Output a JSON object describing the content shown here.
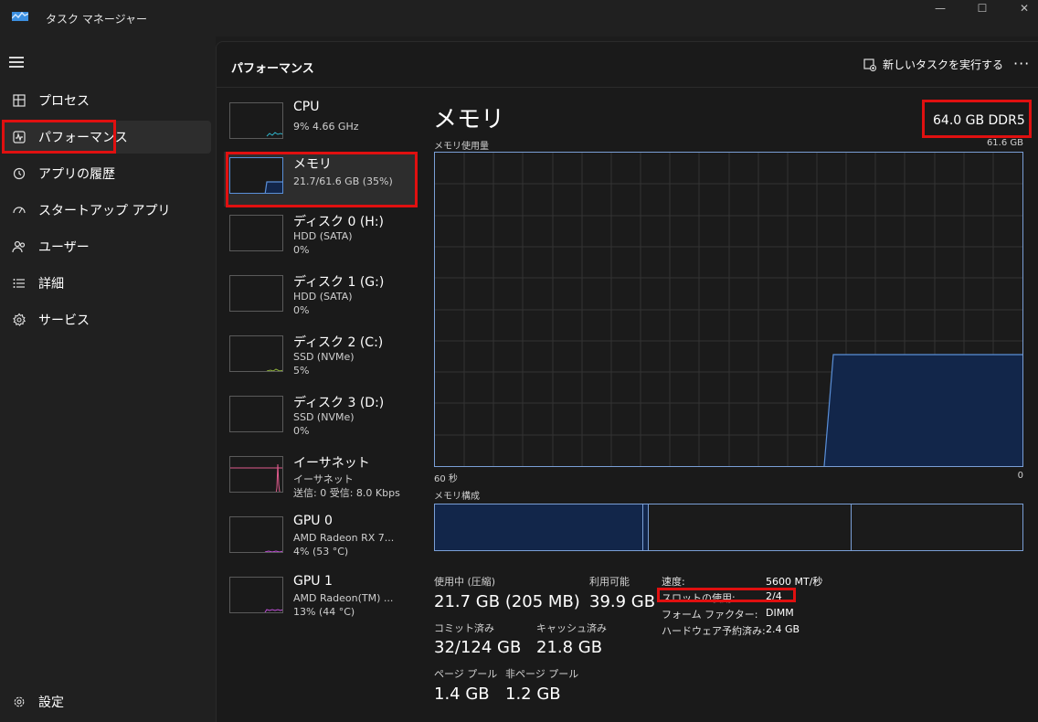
{
  "window": {
    "title": "タスク マネージャー",
    "minimize": "—",
    "maximize": "☐",
    "close": "✕"
  },
  "nav": {
    "items": [
      {
        "label": "プロセス",
        "icon": "processes-icon"
      },
      {
        "label": "パフォーマンス",
        "icon": "performance-icon"
      },
      {
        "label": "アプリの履歴",
        "icon": "history-icon"
      },
      {
        "label": "スタートアップ アプリ",
        "icon": "startup-icon"
      },
      {
        "label": "ユーザー",
        "icon": "users-icon"
      },
      {
        "label": "詳細",
        "icon": "details-icon"
      },
      {
        "label": "サービス",
        "icon": "services-icon"
      }
    ],
    "settings_label": "設定"
  },
  "header": {
    "title": "パフォーマンス",
    "run_task_label": "新しいタスクを実行する",
    "more_label": "···"
  },
  "devices": [
    {
      "name": "CPU",
      "lines": [
        "9%  4.66 GHz"
      ]
    },
    {
      "name": "メモリ",
      "lines": [
        "21.7/61.6 GB (35%)"
      ]
    },
    {
      "name": "ディスク 0 (H:)",
      "lines": [
        "HDD (SATA)",
        "0%"
      ]
    },
    {
      "name": "ディスク 1 (G:)",
      "lines": [
        "HDD (SATA)",
        "0%"
      ]
    },
    {
      "name": "ディスク 2 (C:)",
      "lines": [
        "SSD (NVMe)",
        "5%"
      ]
    },
    {
      "name": "ディスク 3 (D:)",
      "lines": [
        "SSD (NVMe)",
        "0%"
      ]
    },
    {
      "name": "イーサネット",
      "lines": [
        "イーサネット",
        "送信: 0 受信: 8.0 Kbps"
      ]
    },
    {
      "name": "GPU 0",
      "lines": [
        "AMD Radeon RX 7...",
        "4% (53 °C)"
      ]
    },
    {
      "name": "GPU 1",
      "lines": [
        "AMD Radeon(TM) ...",
        "13% (44 °C)"
      ]
    }
  ],
  "detail": {
    "title": "メモリ",
    "spec": "64.0 GB DDR5",
    "usage_label": "メモリ使用量",
    "usage_max": "61.6 GB",
    "time_left": "60 秒",
    "time_right": "0",
    "composition_label": "メモリ構成",
    "in_use_fraction": 0.35,
    "stats": {
      "in_use_label": "使用中 (圧縮)",
      "in_use_value": "21.7 GB (205 MB)",
      "available_label": "利用可能",
      "available_value": "39.9 GB",
      "committed_label": "コミット済み",
      "committed_value": "32/124 GB",
      "cached_label": "キャッシュ済み",
      "cached_value": "21.8 GB",
      "paged_label": "ページ プール",
      "paged_value": "1.4 GB",
      "nonpaged_label": "非ページ プール",
      "nonpaged_value": "1.2 GB"
    },
    "kv": [
      {
        "key": "速度:",
        "value": "5600 MT/秒"
      },
      {
        "key": "スロットの使用:",
        "value": "2/4"
      },
      {
        "key": "フォーム ファクター:",
        "value": "DIMM"
      },
      {
        "key": "ハードウェア予約済み:",
        "value": "2.4 GB"
      }
    ]
  },
  "colors": {
    "accent_memory": "#5a8fd8",
    "fill_memory": "#12264a",
    "highlight": "#e01010",
    "cpu_line": "#2fb3c9",
    "disk_line": "#8fb33a",
    "eth_line": "#e05a8c",
    "gpu_line": "#c050d8"
  }
}
